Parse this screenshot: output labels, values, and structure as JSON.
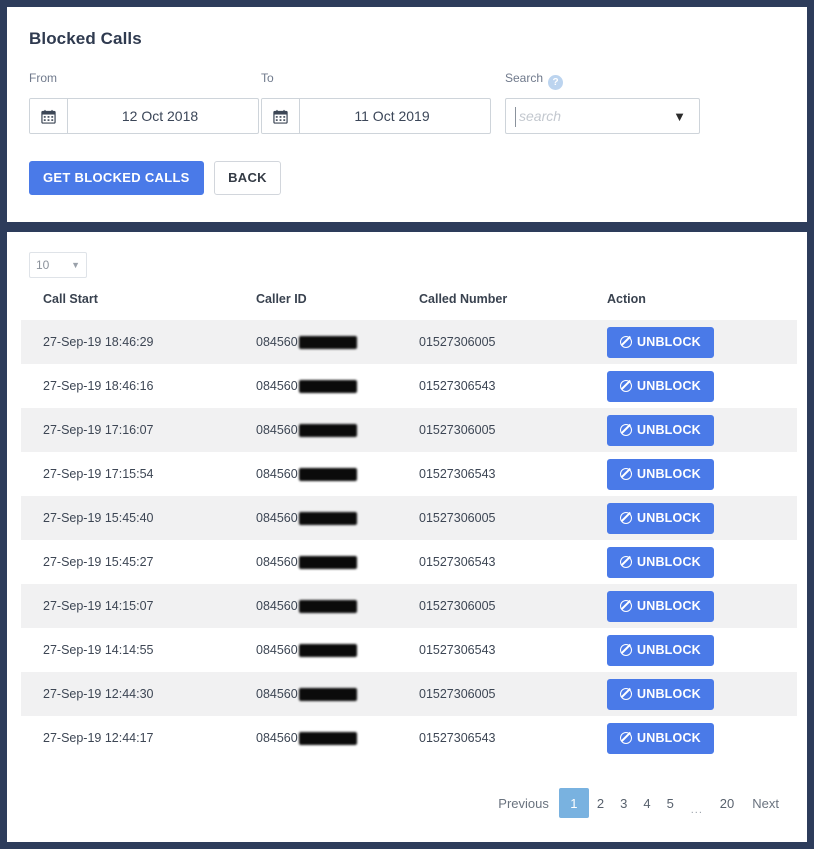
{
  "theme": {
    "page_background": "#2d3c5b",
    "card_background": "#ffffff",
    "primary_blue": "#4a7ae8",
    "active_page_blue": "#79b2e0",
    "stripe_gray": "#f1f1f2"
  },
  "filter_card": {
    "title": "Blocked Calls",
    "from": {
      "label": "From",
      "value": "12 Oct 2018",
      "icon": "calendar-icon"
    },
    "to": {
      "label": "To",
      "value": "11 Oct 2019",
      "icon": "calendar-icon"
    },
    "search": {
      "label": "Search",
      "help_icon": "?",
      "value": "",
      "placeholder": "search",
      "caret": "▼"
    },
    "buttons": {
      "submit": "GET BLOCKED CALLS",
      "back": "BACK"
    }
  },
  "table_card": {
    "page_size": {
      "value": "10",
      "caret": "▼"
    },
    "columns": [
      "Call Start",
      "Caller ID",
      "Called Number",
      "Action"
    ],
    "rows": [
      {
        "call_start": "27-Sep-19 18:46:29",
        "caller_id_prefix": "084560",
        "caller_id_redacted": true,
        "called_number": "01527306005",
        "action": "UNBLOCK"
      },
      {
        "call_start": "27-Sep-19 18:46:16",
        "caller_id_prefix": "084560",
        "caller_id_redacted": true,
        "called_number": "01527306543",
        "action": "UNBLOCK"
      },
      {
        "call_start": "27-Sep-19 17:16:07",
        "caller_id_prefix": "084560",
        "caller_id_redacted": true,
        "called_number": "01527306005",
        "action": "UNBLOCK"
      },
      {
        "call_start": "27-Sep-19 17:15:54",
        "caller_id_prefix": "084560",
        "caller_id_redacted": true,
        "called_number": "01527306543",
        "action": "UNBLOCK"
      },
      {
        "call_start": "27-Sep-19 15:45:40",
        "caller_id_prefix": "084560",
        "caller_id_redacted": true,
        "called_number": "01527306005",
        "action": "UNBLOCK"
      },
      {
        "call_start": "27-Sep-19 15:45:27",
        "caller_id_prefix": "084560",
        "caller_id_redacted": true,
        "called_number": "01527306543",
        "action": "UNBLOCK"
      },
      {
        "call_start": "27-Sep-19 14:15:07",
        "caller_id_prefix": "084560",
        "caller_id_redacted": true,
        "called_number": "01527306005",
        "action": "UNBLOCK"
      },
      {
        "call_start": "27-Sep-19 14:14:55",
        "caller_id_prefix": "084560",
        "caller_id_redacted": true,
        "called_number": "01527306543",
        "action": "UNBLOCK"
      },
      {
        "call_start": "27-Sep-19 12:44:30",
        "caller_id_prefix": "084560",
        "caller_id_redacted": true,
        "called_number": "01527306005",
        "action": "UNBLOCK"
      },
      {
        "call_start": "27-Sep-19 12:44:17",
        "caller_id_prefix": "084560",
        "caller_id_redacted": true,
        "called_number": "01527306543",
        "action": "UNBLOCK"
      }
    ],
    "pagination": {
      "previous": "Previous",
      "next": "Next",
      "pages": [
        "1",
        "2",
        "3",
        "4",
        "5"
      ],
      "ellipsis": "...",
      "last_page": "20",
      "active_page": "1"
    }
  }
}
